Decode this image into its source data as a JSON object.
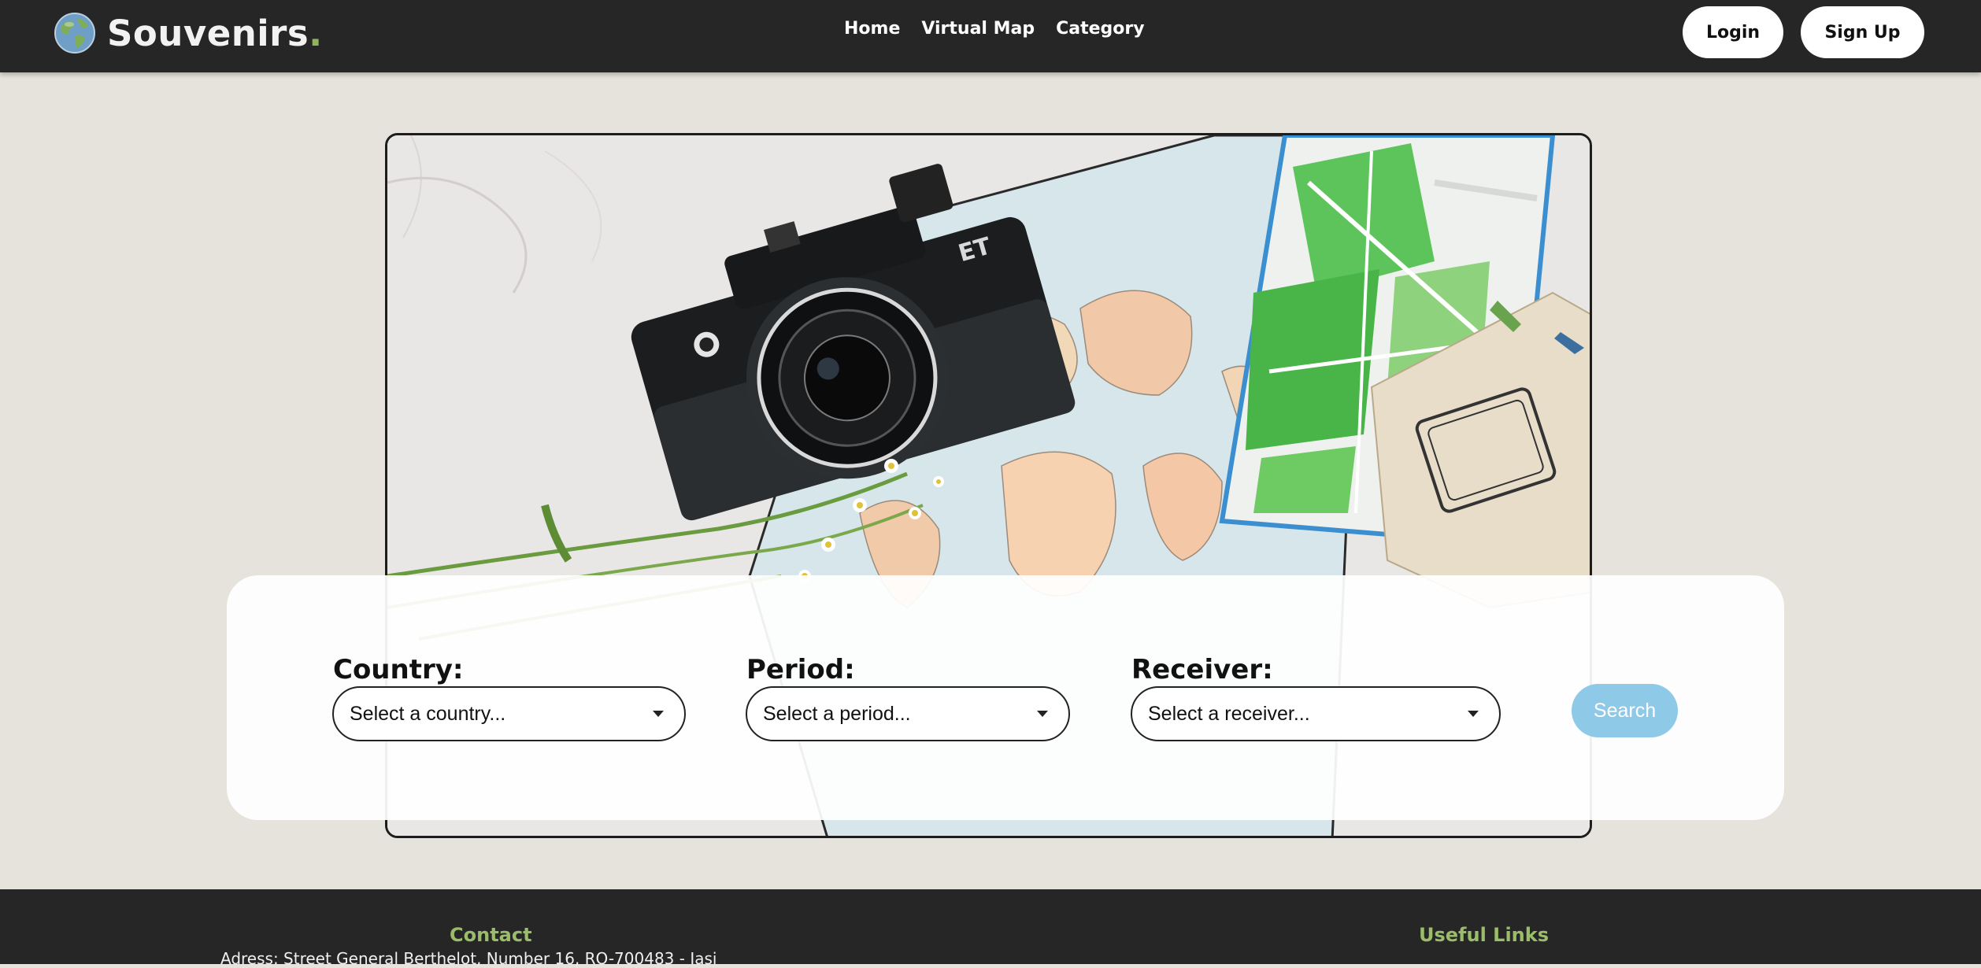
{
  "brand": {
    "name": "Souvenirs",
    "dot": ".",
    "logo_icon": "globe-icon"
  },
  "nav": {
    "links": [
      "Home",
      "Virtual Map",
      "Category"
    ]
  },
  "auth": {
    "login_label": "Login",
    "signup_label": "Sign Up"
  },
  "hero": {
    "image_subject": "camera-map-flowers-passport-photo",
    "camera_badge": "ET"
  },
  "search": {
    "country": {
      "label": "Country:",
      "placeholder": "Select a country..."
    },
    "period": {
      "label": "Period:",
      "placeholder": "Select a period..."
    },
    "receiver": {
      "label": "Receiver:",
      "placeholder": "Select a receiver..."
    },
    "button_label": "Search"
  },
  "footer": {
    "contact_heading": "Contact",
    "address": "Adress: Street General Berthelot, Number 16, RO-700483 - Iasi",
    "links_heading": "Useful Links"
  },
  "colors": {
    "navbar_bg": "#262626",
    "page_bg": "#e6e3dc",
    "accent_green": "#9bbd6b",
    "search_button": "#8ec9e8"
  }
}
